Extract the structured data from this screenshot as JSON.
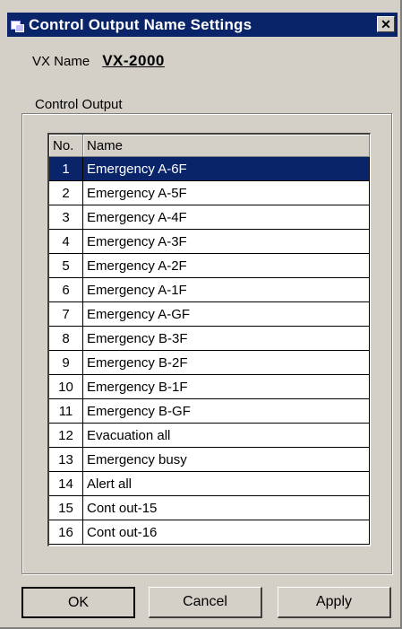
{
  "window": {
    "title": "Control Output Name Settings",
    "close_label": "✕"
  },
  "vx": {
    "label": "VX Name",
    "value": "VX-2000"
  },
  "group": {
    "label": "Control Output"
  },
  "table": {
    "headers": {
      "no": "No.",
      "name": "Name"
    },
    "selected_row": 1,
    "rows": [
      {
        "no": "1",
        "name": "Emergency A-6F"
      },
      {
        "no": "2",
        "name": "Emergency A-5F"
      },
      {
        "no": "3",
        "name": "Emergency A-4F"
      },
      {
        "no": "4",
        "name": "Emergency A-3F"
      },
      {
        "no": "5",
        "name": "Emergency A-2F"
      },
      {
        "no": "6",
        "name": "Emergency A-1F"
      },
      {
        "no": "7",
        "name": "Emergency A-GF"
      },
      {
        "no": "8",
        "name": "Emergency B-3F"
      },
      {
        "no": "9",
        "name": "Emergency B-2F"
      },
      {
        "no": "10",
        "name": "Emergency B-1F"
      },
      {
        "no": "11",
        "name": "Emergency B-GF"
      },
      {
        "no": "12",
        "name": "Evacuation all"
      },
      {
        "no": "13",
        "name": "Emergency busy"
      },
      {
        "no": "14",
        "name": "Alert all"
      },
      {
        "no": "15",
        "name": "Cont out-15"
      },
      {
        "no": "16",
        "name": "Cont out-16"
      }
    ]
  },
  "buttons": {
    "ok": "OK",
    "cancel": "Cancel",
    "apply": "Apply"
  },
  "colors": {
    "title_bar": "#0a246a",
    "dialog_bg": "#d4d0c8",
    "selection": "#0a246a"
  }
}
